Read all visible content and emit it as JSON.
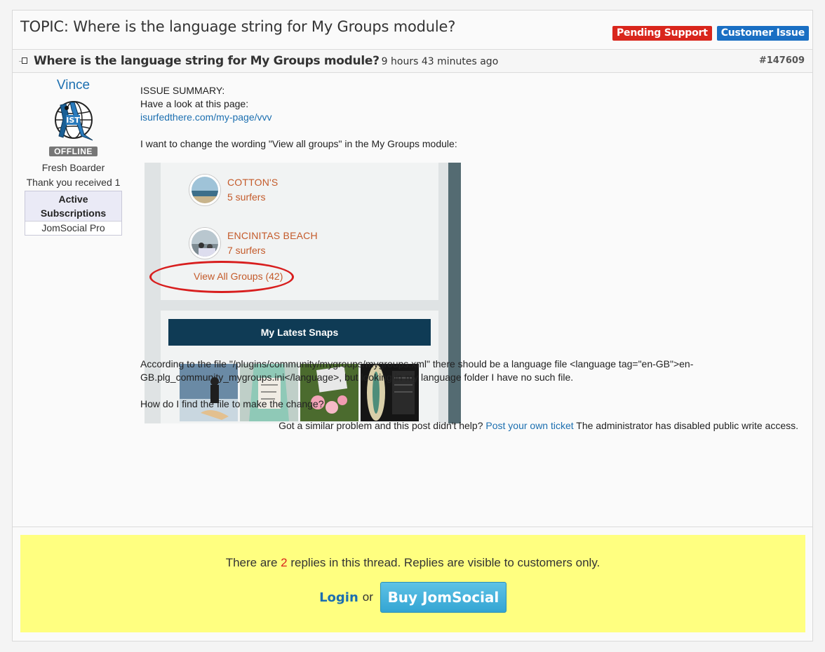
{
  "topic": {
    "title": "TOPIC: Where is the language string for My Groups module?",
    "badges": [
      {
        "label": "Pending Support",
        "color": "#d9261c"
      },
      {
        "label": "Customer Issue",
        "color": "#1a6fc3"
      }
    ]
  },
  "post": {
    "title": "Where is the language string for My Groups module?",
    "time": "9 hours 43 minutes ago",
    "id": "#147609",
    "author": {
      "name": "Vince",
      "avatar_icon": "surfer-globe-logo",
      "status": "OFFLINE",
      "rank": "Fresh Boarder",
      "thanks": "Thank you received 1",
      "subscriptions_header": "Active Subscriptions",
      "subscriptions": [
        "JomSocial Pro"
      ]
    },
    "summary_label": "ISSUE SUMMARY:",
    "line1": "Have a look at this page:",
    "link": "isurfedthere.com/my-page/vvv",
    "line2": "I want to change the wording \"View all groups\" in the My Groups module:",
    "screenshot": {
      "groups": [
        {
          "name": "COTTON'S",
          "count": "5 surfers"
        },
        {
          "name": "ENCINITAS BEACH",
          "count": "7 surfers"
        }
      ],
      "view_all": "View All Groups (42)",
      "snaps_title": "My Latest Snaps"
    },
    "para1": "According to the file \"/plugins/community/mygroups/mygroups.xml\" there should be a language file <language tag=\"en-GB\">en-GB.plg_community_mygroups.ini</language>, but looking in my language folder I have no such file.",
    "para2": "How do I find the file to make the change?",
    "similar": {
      "prefix": "Got a similar problem and this post didn't help?",
      "link": "Post your own ticket",
      "suffix": "The administrator has disabled public write access."
    }
  },
  "cta": {
    "text_before": "There are",
    "count": "2",
    "text_after": "replies in this thread. Replies are visible to customers only.",
    "login": "Login",
    "or": "or",
    "buy": "Buy JomSocial"
  }
}
